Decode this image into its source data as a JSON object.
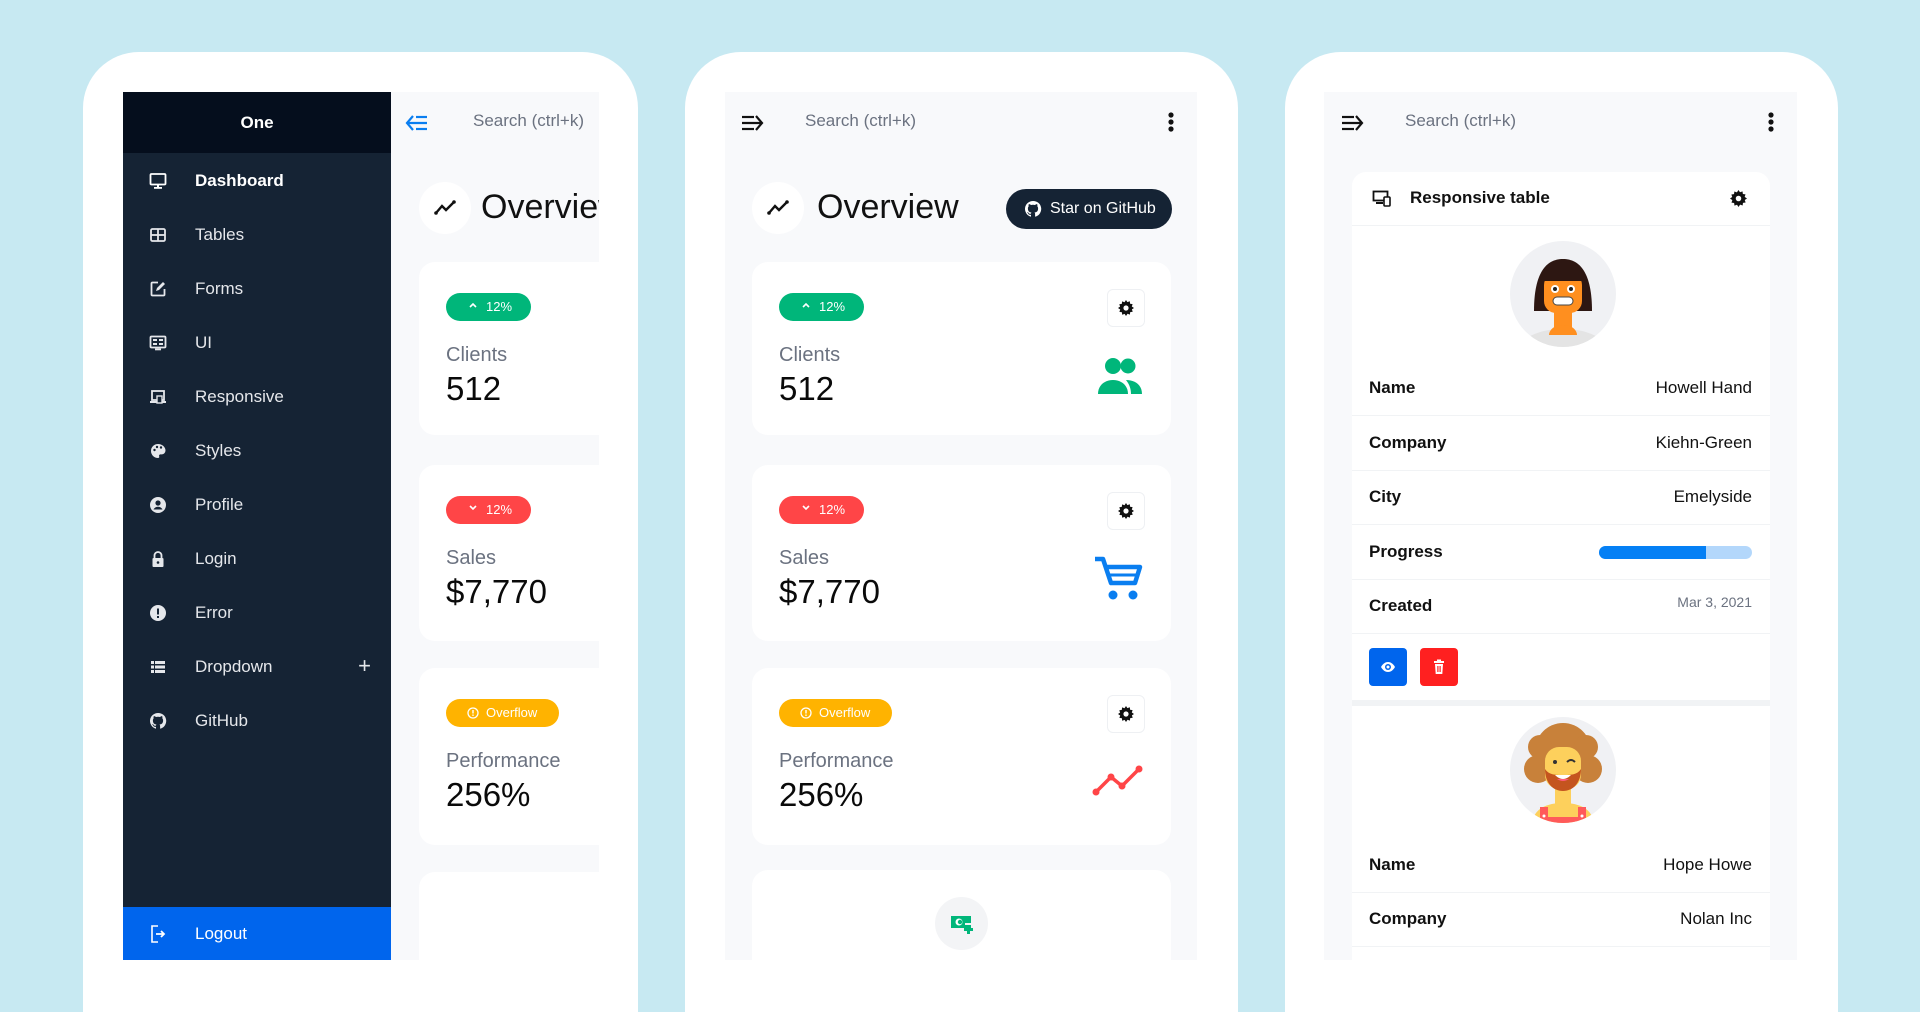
{
  "search_placeholder": "Search (ctrl+k)",
  "sidebar": {
    "brand": "One",
    "items": [
      {
        "label": "Dashboard",
        "icon": "monitor-icon",
        "active": true
      },
      {
        "label": "Tables",
        "icon": "table-icon"
      },
      {
        "label": "Forms",
        "icon": "edit-square-icon"
      },
      {
        "label": "UI",
        "icon": "ui-card-icon"
      },
      {
        "label": "Responsive",
        "icon": "responsive-icon"
      },
      {
        "label": "Styles",
        "icon": "palette-icon"
      },
      {
        "label": "Profile",
        "icon": "account-circle-icon"
      },
      {
        "label": "Login",
        "icon": "lock-icon"
      },
      {
        "label": "Error",
        "icon": "alert-circle-icon"
      },
      {
        "label": "Dropdown",
        "icon": "list-icon",
        "expand": "+"
      },
      {
        "label": "GitHub",
        "icon": "github-icon"
      }
    ],
    "logout": "Logout"
  },
  "overview": {
    "title": "Overview",
    "github_button": "Star on GitHub"
  },
  "stats": [
    {
      "label": "Clients",
      "value": "512",
      "badge": "12%",
      "badge_type": "up",
      "badge_color": "#00b67a",
      "icon": "account-multiple-icon",
      "icon_color": "#00b67a"
    },
    {
      "label": "Sales",
      "value": "$7,770",
      "badge": "12%",
      "badge_type": "down",
      "badge_color": "#ff4547",
      "icon": "cart-icon",
      "icon_color": "#0a7ef0"
    },
    {
      "label": "Performance",
      "value": "256%",
      "badge": "Overflow",
      "badge_type": "alert",
      "badge_color": "#ffb300",
      "icon": "chart-line-icon",
      "icon_color": "#ff4547"
    }
  ],
  "responsive_table": {
    "title": "Responsive table",
    "records": [
      {
        "name": "Howell Hand",
        "company": "Kiehn-Green",
        "city": "Emelyside",
        "progress": 70,
        "created": "Mar 3, 2021"
      },
      {
        "name": "Hope Howe",
        "company": "Nolan Inc"
      }
    ],
    "labels": {
      "name": "Name",
      "company": "Company",
      "city": "City",
      "progress": "Progress",
      "created": "Created"
    }
  }
}
